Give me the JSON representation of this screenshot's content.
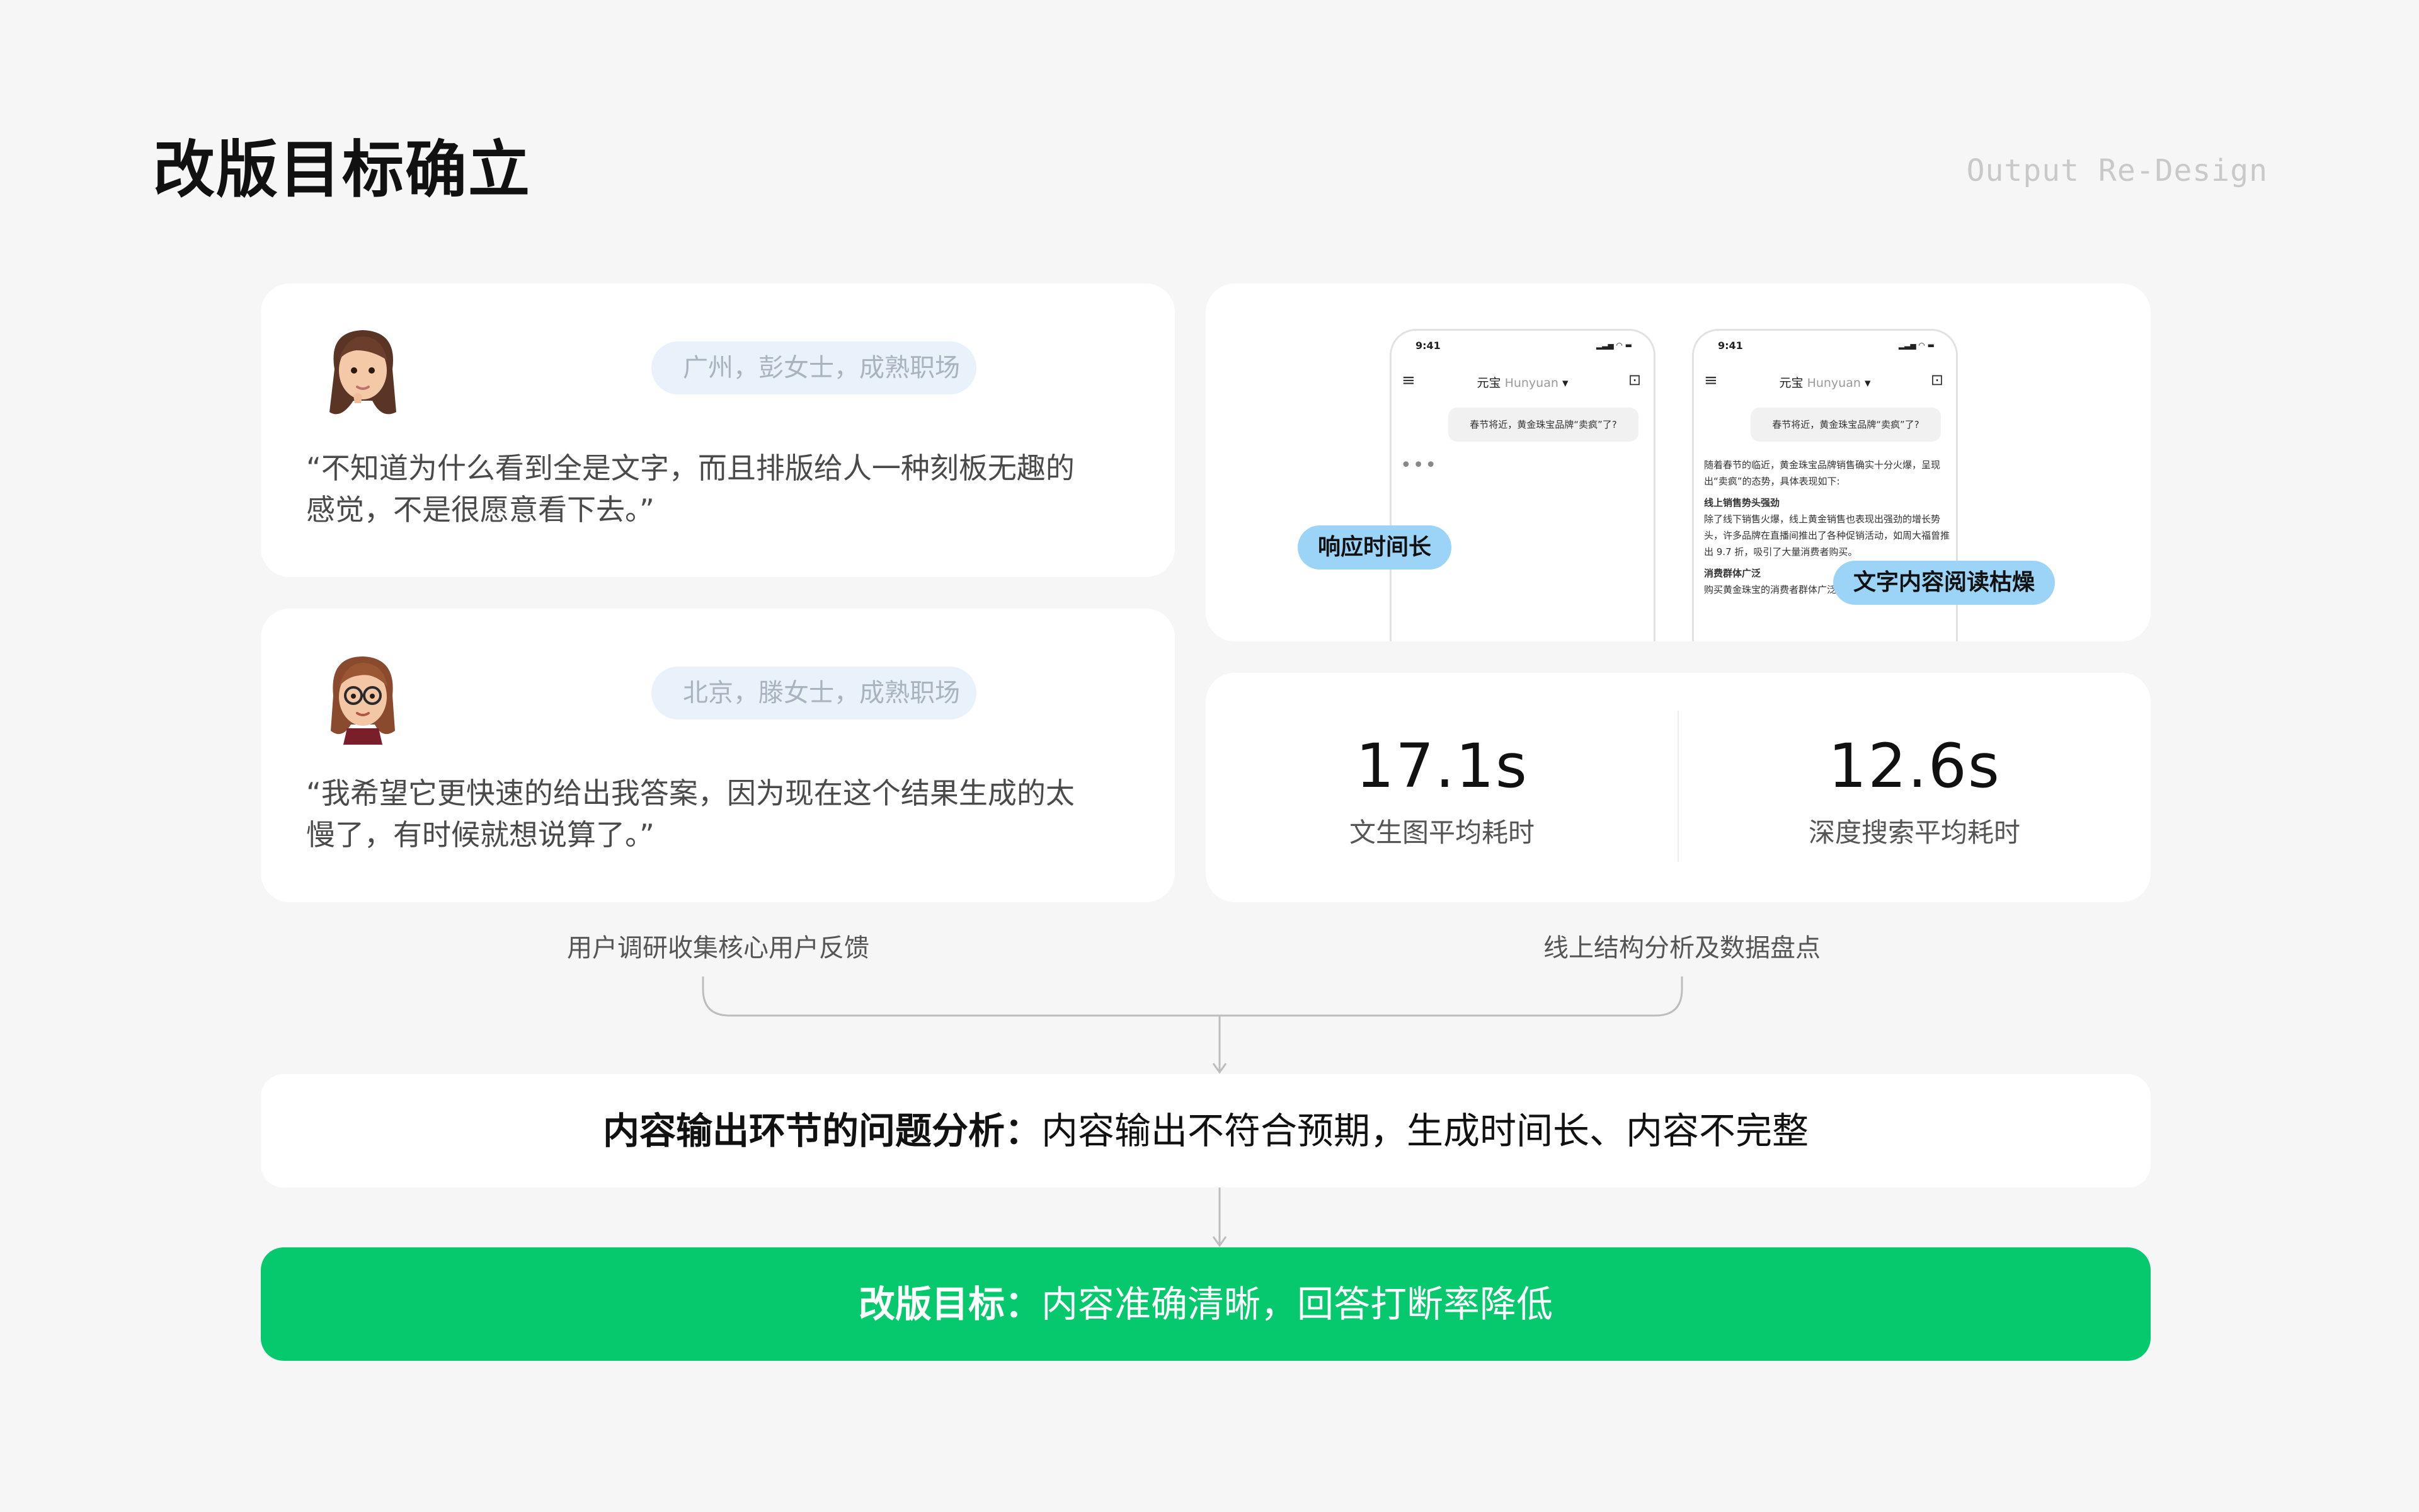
{
  "header": {
    "title": "改版目标确立",
    "subtitle": "Output Re-Design"
  },
  "feedback": [
    {
      "avatar_icon": "memoji-woman-brown-hair-icon",
      "tag": "广州，彭女士，成熟职场",
      "quote_line1": "“不知道为什么看到全是文字，而且排版给人一种刻板无趣的",
      "quote_line2": "感觉，不是很愿意看下去。”"
    },
    {
      "avatar_icon": "memoji-woman-glasses-icon",
      "tag": "北京，滕女士，成熟职场",
      "quote_line1": "“我希望它更快速的给出我答案，因为现在这个结果生成的太",
      "quote_line2": "慢了，有时候就想说算了。”"
    }
  ],
  "phones": {
    "time": "9:41",
    "app_title": "元宝",
    "model": "Hunyuan",
    "question": "春节将近，黄金珠宝品牌“卖疯”了?",
    "answer_intro": "随着春节的临近，黄金珠宝品牌销售确实十分火爆，呈现出“卖疯”的态势，具体表现如下:",
    "section1_title": "线上销售势头强劲",
    "section1_body": "除了线下销售火爆，线上黄金销售也表现出强劲的增长势头，许多品牌在直播间推出了各种促销活动，如周大福曾推出 9.7 折，吸引了大量消费者购买。",
    "section2_title": "消费群体广泛",
    "section2_body": "购买黄金珠宝的消费者群体广泛，不仅有本地消费"
  },
  "callouts": {
    "slow": "响应时间长",
    "dull": "文字内容阅读枯燥"
  },
  "stats": [
    {
      "value": "17.1s",
      "label": "文生图平均耗时"
    },
    {
      "value": "12.6s",
      "label": "深度搜索平均耗时"
    }
  ],
  "captions": {
    "left": "用户调研收集核心用户反馈",
    "right": "线上结构分析及数据盘点"
  },
  "analysis": {
    "label": "内容输出环节的问题分析：",
    "text": "内容输出不符合预期，生成时间长、内容不完整"
  },
  "goal": {
    "label": "改版目标：",
    "text": "内容准确清晰，回答打断率降低"
  },
  "colors": {
    "accent_green": "#05c96c",
    "callout_blue": "#9bd4f7",
    "tag_bg": "#e9f1fb",
    "background": "#f6f6f6"
  }
}
